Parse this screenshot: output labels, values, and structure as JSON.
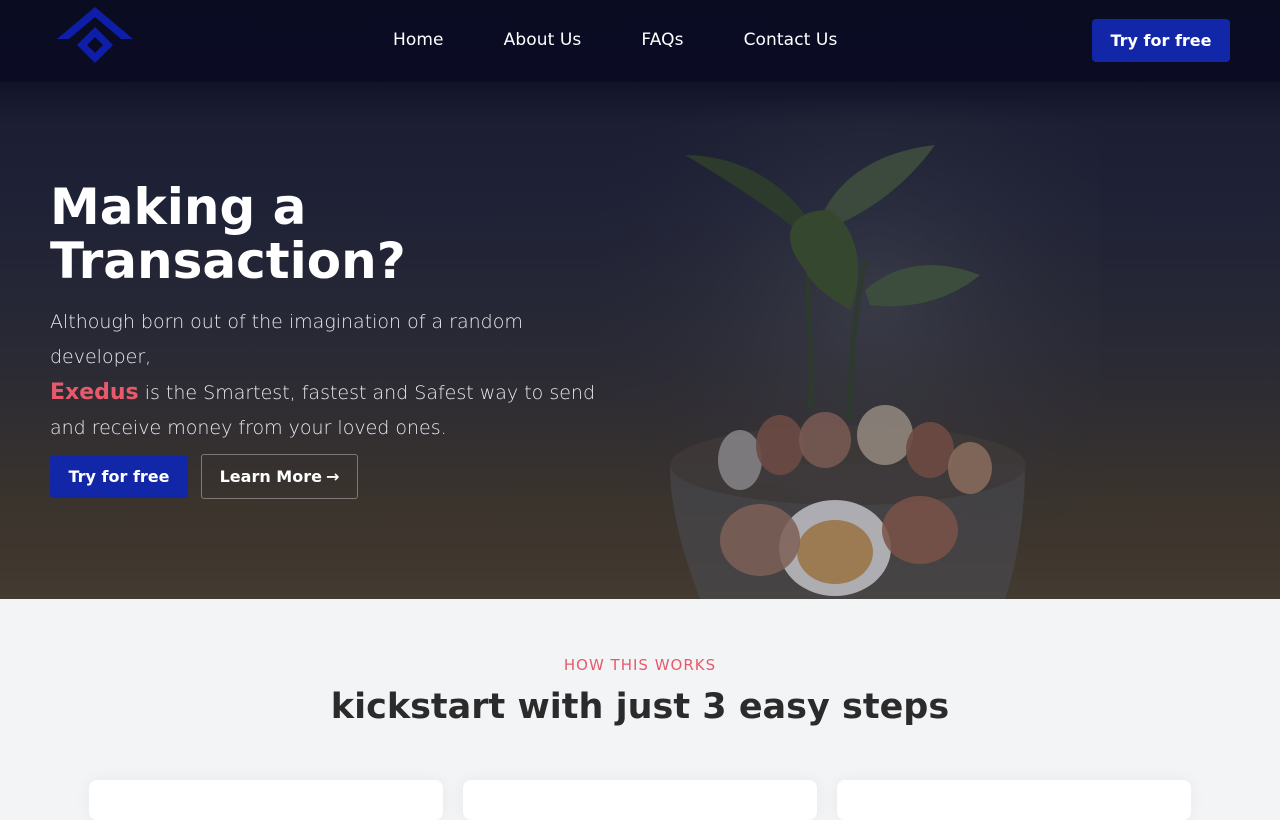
{
  "nav": {
    "links": [
      "Home",
      "About Us",
      "FAQs",
      "Contact Us"
    ],
    "cta": "Try for free",
    "logo_icon": "diamond-roof-logo"
  },
  "hero": {
    "title": "Making a Transaction?",
    "desc_lead": "Although born out of the imagination of a random developer,",
    "brand": "Exedus",
    "desc_rest": "is the Smartest, fastest and Safest way to send and receive money from your loved ones.",
    "primary_button": "Try for free",
    "secondary_button": "Learn More",
    "secondary_icon": "arrow-right-icon"
  },
  "how": {
    "eyebrow": "HOW THIS WORKS",
    "title": "kickstart with just 3 easy steps"
  },
  "colors": {
    "brand_blue": "#1227a8",
    "accent_red": "#e85a6b",
    "nav_bg": "#0a0b22"
  }
}
